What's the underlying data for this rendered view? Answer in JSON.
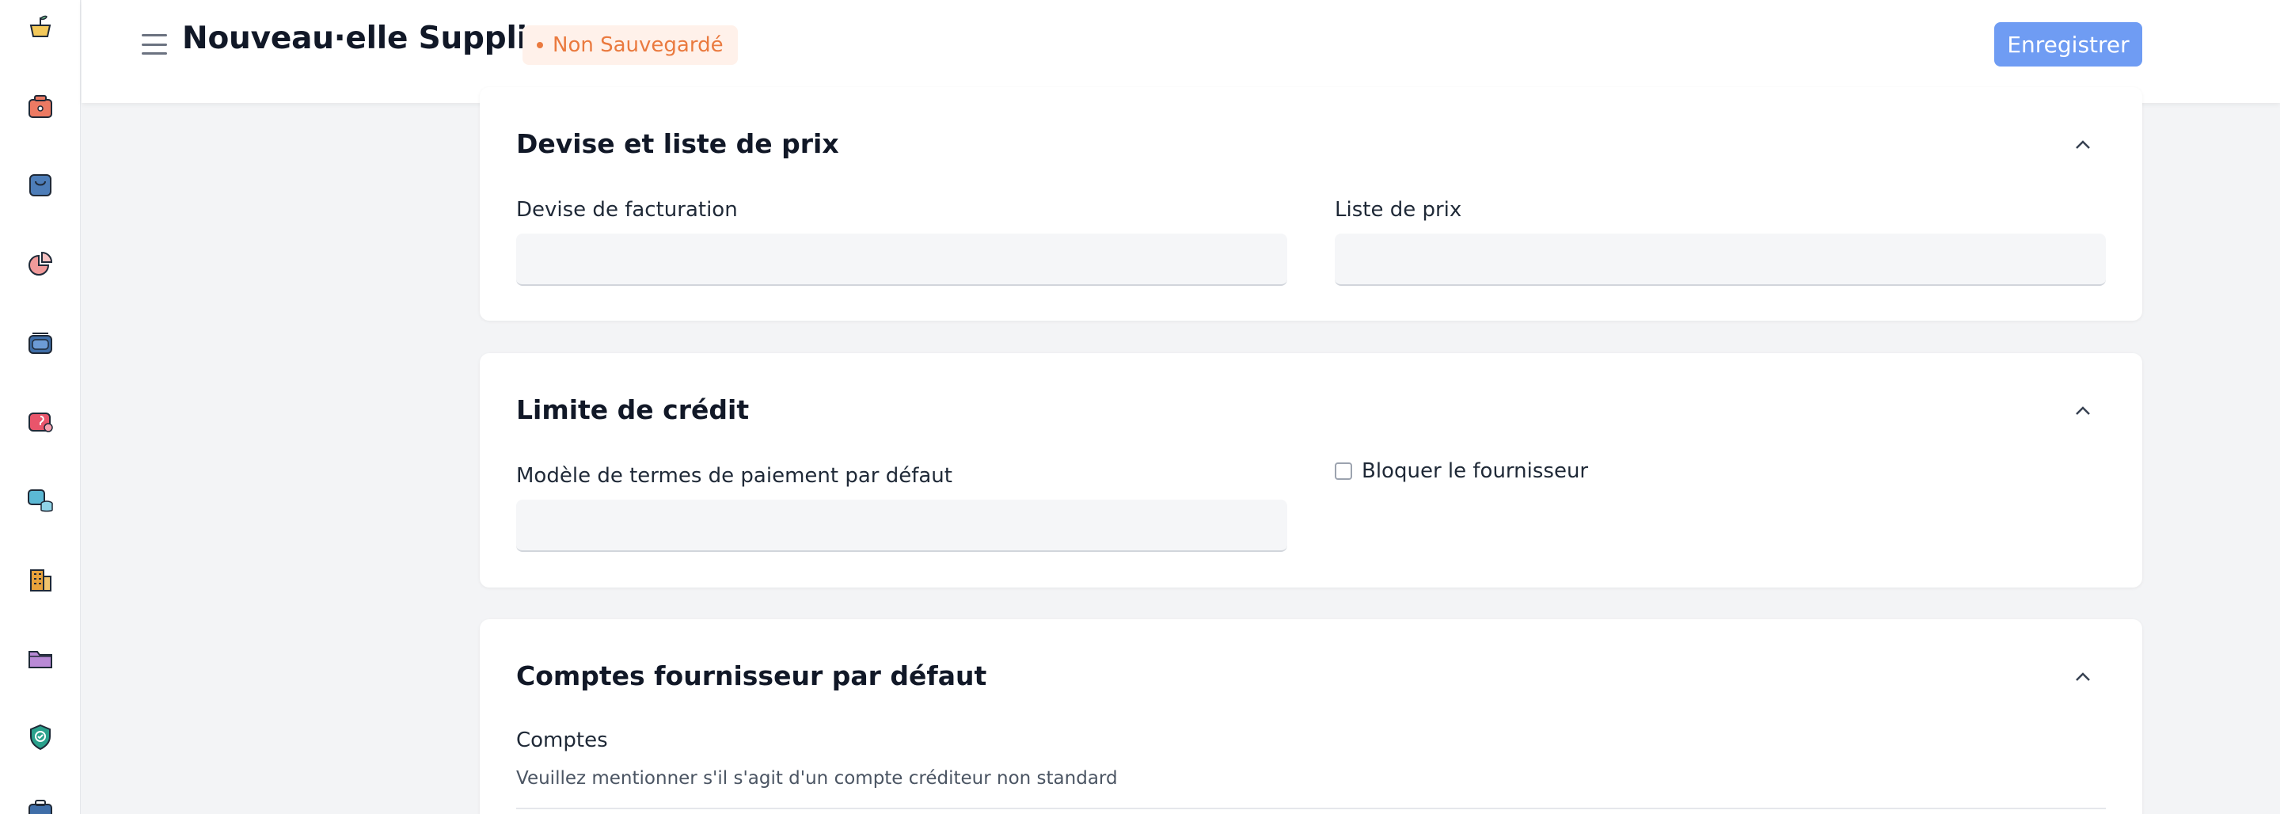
{
  "rail": {
    "icons": [
      "home-plant-icon",
      "sales-icon",
      "purchase-bag-icon",
      "reports-pie-icon",
      "inventory-icon",
      "support-icon",
      "database-icon",
      "buildings-icon",
      "folder-icon",
      "security-shield-icon",
      "briefcase-icon"
    ]
  },
  "header": {
    "title": "Nouveau·elle Supplier",
    "status": "Non Sauvegardé",
    "save_label": "Enregistrer"
  },
  "sections": {
    "currency": {
      "title": "Devise et liste de prix",
      "billing_currency_label": "Devise de facturation",
      "billing_currency_value": "",
      "price_list_label": "Liste de prix",
      "price_list_value": ""
    },
    "credit": {
      "title": "Limite de crédit",
      "payment_terms_label": "Modèle de termes de paiement par défaut",
      "payment_terms_value": "",
      "block_supplier_label": "Bloquer le fournisseur",
      "block_supplier_checked": false
    },
    "accounts": {
      "title": "Comptes fournisseur par défaut",
      "accounts_label": "Comptes",
      "accounts_description": "Veuillez mentionner s'il s'agit d'un compte créditeur non standard"
    }
  },
  "colors": {
    "accent": "#6f9cf3",
    "status_text": "#ea7a3f",
    "status_bg": "#fff1ea"
  }
}
